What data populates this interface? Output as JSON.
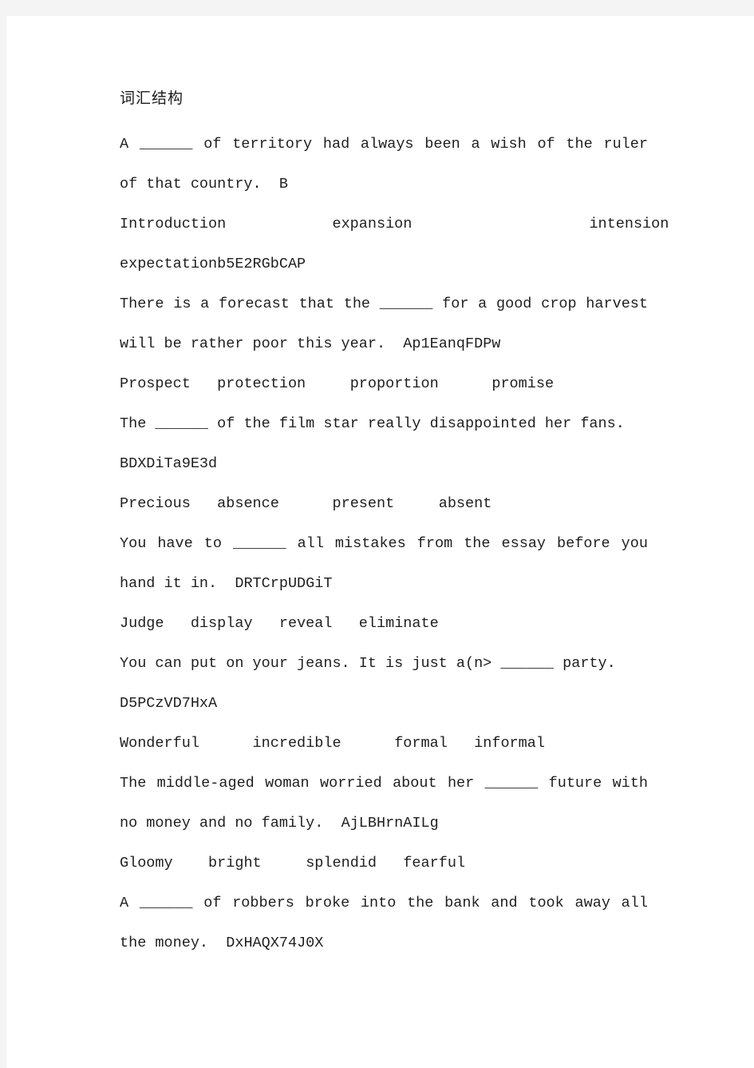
{
  "document": {
    "title": "词汇结构",
    "blank": "______",
    "items": [
      {
        "question_pre": "A ",
        "question_post": " of territory had always been a wish of the ruler of that country.",
        "watermark": "B",
        "options": [
          "Introduction",
          "expansion",
          "intension",
          "expectation"
        ],
        "options_watermark": "b5E2RGbCAP",
        "options_layout": "wide"
      },
      {
        "question_pre": "There is a forecast that the ",
        "question_post": " for a good crop harvest will be rather poor this year.",
        "watermark": "Ap1EanqFDPw",
        "options": [
          "Prospect",
          "protection",
          "proportion",
          "promise"
        ],
        "options_watermark": "",
        "options_layout": "normal"
      },
      {
        "question_pre": "The ",
        "question_post": " of the film star really disappointed her fans.",
        "watermark": "BDXDiTa9E3d",
        "options": [
          "Precious",
          "absence",
          "present",
          "absent"
        ],
        "options_watermark": "",
        "options_layout": "normal"
      },
      {
        "question_pre": "You have to ",
        "question_post": " all mistakes from the essay before you hand it in.",
        "watermark": "DRTCrpUDGiT",
        "options": [
          "Judge",
          "display",
          "reveal",
          "eliminate"
        ],
        "options_watermark": "",
        "options_layout": "tight"
      },
      {
        "question_pre": "You can put on your jeans. It is just a(n> ",
        "question_post": " party.",
        "watermark": "D5PCzVD7HxA",
        "options": [
          "Wonderful",
          "incredible",
          "formal",
          "informal"
        ],
        "options_watermark": "",
        "options_layout": "normal"
      },
      {
        "question_pre": "The middle-aged woman worried about her ",
        "question_post": " future with no money and no family.",
        "watermark": "AjLBHrnAILg",
        "options": [
          "Gloomy",
          "bright",
          "splendid",
          "fearful"
        ],
        "options_watermark": "",
        "options_layout": "normal"
      },
      {
        "question_pre": "A ",
        "question_post": " of robbers broke into the bank and took away all the money.",
        "watermark": "DxHAQX74J0X",
        "options": [],
        "options_watermark": "",
        "options_layout": "normal"
      }
    ]
  }
}
